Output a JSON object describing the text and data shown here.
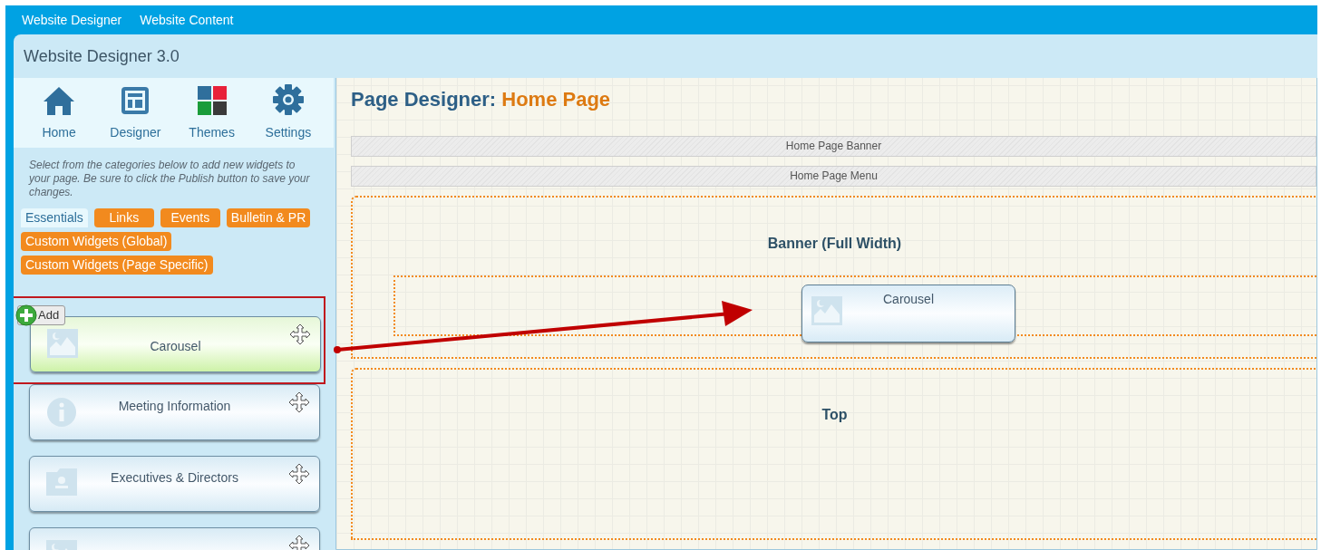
{
  "top_menu": [
    {
      "label": "Website Designer"
    },
    {
      "label": "Website Content"
    }
  ],
  "app_title": "Website Designer 3.0",
  "nav": [
    {
      "label": "Home",
      "kind": "home"
    },
    {
      "label": "Designer",
      "kind": "layout"
    },
    {
      "label": "Themes",
      "kind": "tiles"
    },
    {
      "label": "Settings",
      "kind": "gear"
    }
  ],
  "instructions": "Select from the categories below to add new widgets to your page. Be sure to click the Publish button to save your changes.",
  "category_tabs": [
    {
      "label": "Essentials",
      "selected": true
    },
    {
      "label": "Links",
      "selected": false
    },
    {
      "label": "Events",
      "selected": false
    },
    {
      "label": "Bulletin & PR",
      "selected": false
    },
    {
      "label": "Custom Widgets (Global)",
      "selected": false
    },
    {
      "label": "Custom Widgets (Page Specific)",
      "selected": false
    }
  ],
  "widgets": [
    {
      "label": "Carousel",
      "kind": "image",
      "highlighted": true,
      "add_badge": "Add"
    },
    {
      "label": "Meeting Information",
      "kind": "info",
      "highlighted": false
    },
    {
      "label": "Executives & Directors",
      "kind": "contact",
      "highlighted": false
    },
    {
      "kind": "image",
      "highlighted": false
    }
  ],
  "canvas": {
    "title": "Page Designer:",
    "page_name": "Home Page",
    "fixed_bars": [
      "Home Page Banner",
      "Home Page Menu"
    ],
    "zones": [
      {
        "label": "Banner (Full Width)",
        "dropped_widget": {
          "label": "Carousel",
          "kind": "image"
        }
      },
      {
        "label": "Top"
      }
    ]
  }
}
